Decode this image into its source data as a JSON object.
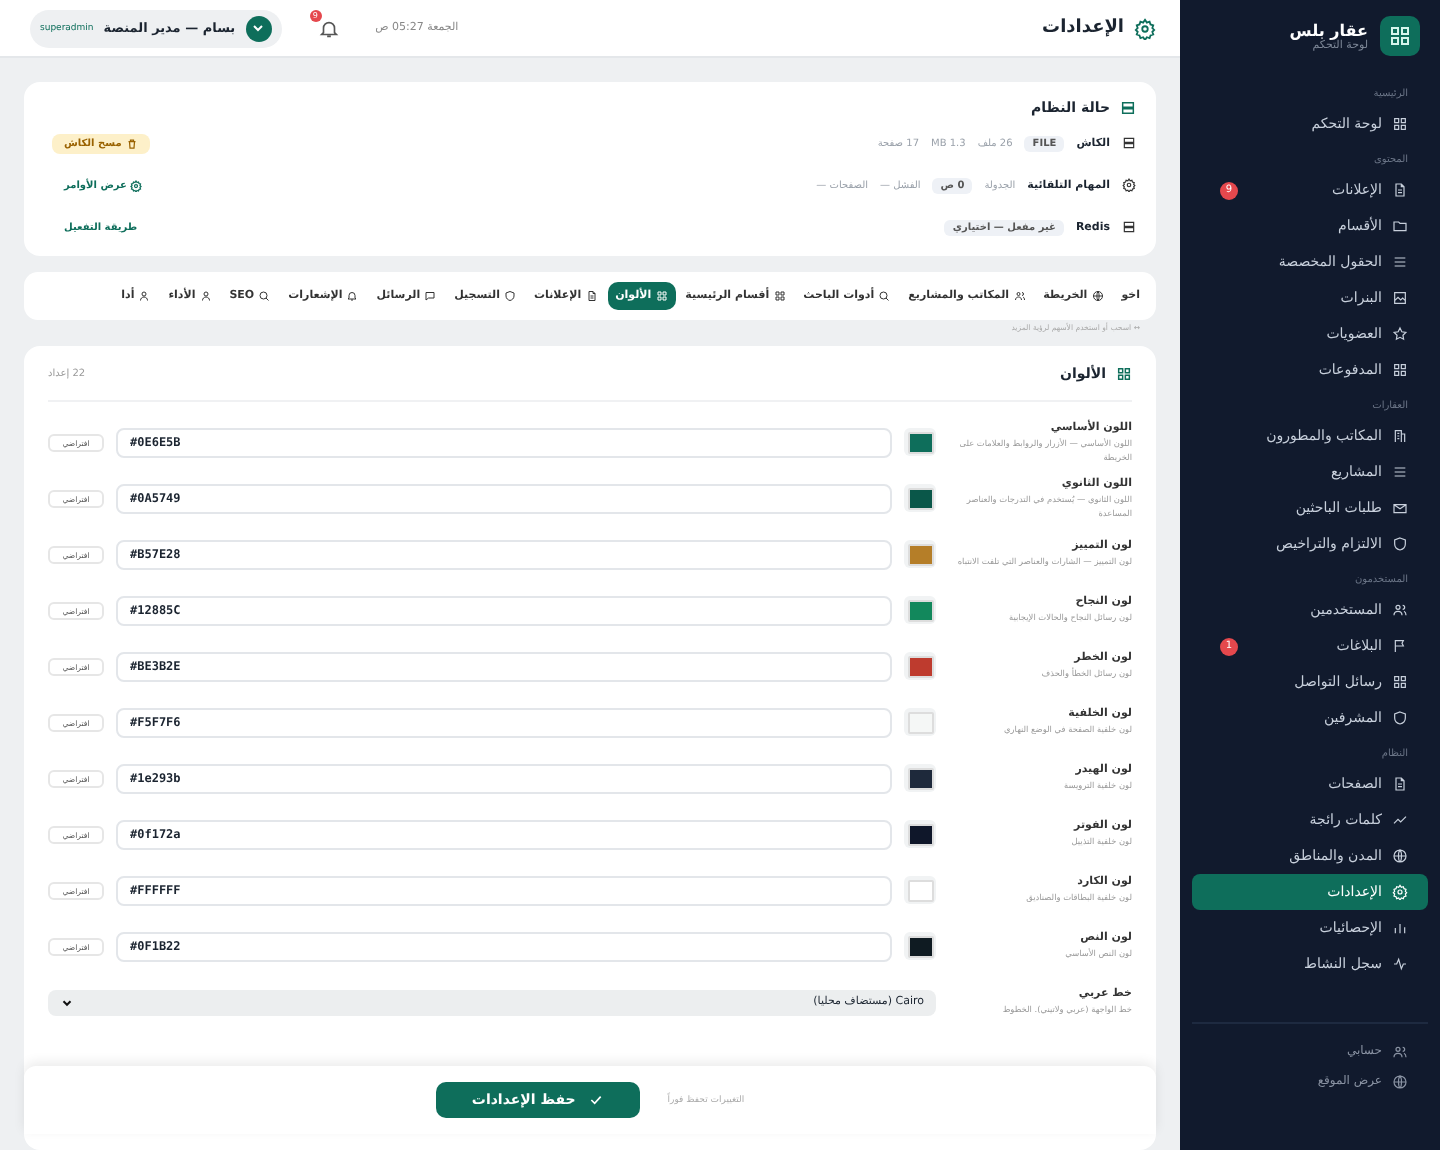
{
  "sidebar": {
    "brand": {
      "name": "عقار بلس",
      "subtitle": "لوحة التحكم"
    },
    "sections": [
      {
        "title": "الرئيسية",
        "items": [
          {
            "label": "لوحة التحكم",
            "selected": false
          }
        ]
      },
      {
        "title": "المحتوى",
        "items": [
          {
            "label": "الإعلانات",
            "selected": false,
            "badge": "9"
          },
          {
            "label": "الأقسام",
            "selected": false
          },
          {
            "label": "الحقول المخصصة",
            "selected": false
          },
          {
            "label": "البنرات",
            "selected": false
          },
          {
            "label": "العضويات",
            "selected": false
          },
          {
            "label": "المدفوعات",
            "selected": false
          }
        ]
      },
      {
        "title": "العقارات",
        "items": [
          {
            "label": "المكاتب والمطورون",
            "selected": false
          },
          {
            "label": "المشاريع",
            "selected": false
          },
          {
            "label": "طلبات الباحثين",
            "selected": false
          },
          {
            "label": "الالتزام والتراخيص",
            "selected": false
          }
        ]
      },
      {
        "title": "المستخدمون",
        "items": [
          {
            "label": "المستخدمين",
            "selected": false
          },
          {
            "label": "البلاغات",
            "selected": false,
            "badge": "1"
          },
          {
            "label": "رسائل التواصل",
            "selected": false
          },
          {
            "label": "المشرفين",
            "selected": false
          }
        ]
      },
      {
        "title": "النظام",
        "items": [
          {
            "label": "الصفحات",
            "selected": false
          },
          {
            "label": "كلمات رائجة",
            "selected": false
          },
          {
            "label": "المدن والمناطق",
            "selected": false
          },
          {
            "label": "الإعدادات",
            "selected": true
          },
          {
            "label": "الإحصائيات",
            "selected": false
          },
          {
            "label": "سجل النشاط",
            "selected": false
          }
        ]
      }
    ],
    "footer": [
      "حسابي",
      "عرض الموقع"
    ]
  },
  "header": {
    "title": "الإعدادات",
    "datetime": "الجمعة 05:27 ص",
    "notifications": "9",
    "user": {
      "name": "بسام — مدير المنصة",
      "role": "superadmin"
    }
  },
  "system_status": {
    "title": "حالة النظام",
    "rows": [
      {
        "label": "الكاش",
        "parts": [
          {
            "text": "FILE",
            "boxed": true
          },
          {
            "text": "26 ملف",
            "boxed": false
          },
          {
            "text": "1.3 MB",
            "boxed": false
          },
          {
            "text": "17 صفحة",
            "boxed": false
          }
        ],
        "action": {
          "label": "مسح الكاش",
          "kind": "warning"
        }
      },
      {
        "label": "المهام التلقائية",
        "parts": [
          {
            "text": "الجدولة",
            "boxed": false
          },
          {
            "text": "0 ص",
            "boxed": true
          },
          {
            "text": "الفشل —",
            "boxed": false
          },
          {
            "text": "الصفحات —",
            "boxed": false
          }
        ],
        "action": {
          "label": "عرض الأوامر",
          "kind": "link"
        }
      },
      {
        "label": "Redis",
        "parts": [
          {
            "text": "غير مفعل — اختياري",
            "boxed": true
          }
        ],
        "action": {
          "label": "طريقة التفعيل",
          "kind": "plain"
        }
      }
    ]
  },
  "tabs": [
    {
      "label": "اخو",
      "selected": false
    },
    {
      "label": "الخريطة",
      "selected": false
    },
    {
      "label": "المكاتب والمشاريع",
      "selected": false
    },
    {
      "label": "أدوات الباحث",
      "selected": false
    },
    {
      "label": "أقسام الرئيسية",
      "selected": false
    },
    {
      "label": "الألوان",
      "selected": true
    },
    {
      "label": "الإعلانات",
      "selected": false
    },
    {
      "label": "التسجيل",
      "selected": false
    },
    {
      "label": "الرسائل",
      "selected": false
    },
    {
      "label": "الإشعارات",
      "selected": false
    },
    {
      "label": "SEO",
      "selected": false
    },
    {
      "label": "الأداء",
      "selected": false
    },
    {
      "label": "أدا",
      "selected": false
    }
  ],
  "tabs_hint": "↔ اسحب أو استخدم الأسهم لرؤية المزيد",
  "colors": {
    "title": "الألوان",
    "count": "22 إعداد",
    "rows": [
      {
        "kind": "color",
        "label": "اللون الأساسي",
        "description": "اللون الأساسي — الأزرار والروابط والعلامات على الخريطة",
        "value": "#0E6E5B",
        "reset": "افتراضي"
      },
      {
        "kind": "color",
        "label": "اللون الثانوي",
        "description": "اللون الثانوي — يُستخدم في التدرجات والعناصر المساعدة",
        "value": "#0A5749",
        "reset": "افتراضي"
      },
      {
        "kind": "color",
        "label": "لون التمييز",
        "description": "لون التمييز — الشارات والعناصر التي تلفت الانتباه",
        "value": "#B57E28",
        "reset": "افتراضي"
      },
      {
        "kind": "color",
        "label": "لون النجاح",
        "description": "لون رسائل النجاح والحالات الإيجابية",
        "value": "#12885C",
        "reset": "افتراضي"
      },
      {
        "kind": "color",
        "label": "لون الخطر",
        "description": "لون رسائل الخطأ والحذف",
        "value": "#BE3B2E",
        "reset": "افتراضي"
      },
      {
        "kind": "color",
        "label": "لون الخلفية",
        "description": "لون خلفية الصفحة في الوضع النهاري",
        "value": "#F5F7F6",
        "reset": "افتراضي"
      },
      {
        "kind": "color",
        "label": "لون الهيدر",
        "description": "لون خلفية الترويسة",
        "value": "#1e293b",
        "reset": "افتراضي"
      },
      {
        "kind": "color",
        "label": "لون الفوتر",
        "description": "لون خلفية التذييل",
        "value": "#0f172a",
        "reset": "افتراضي"
      },
      {
        "kind": "color",
        "label": "لون الكارد",
        "description": "لون خلفية البطاقات والصناديق",
        "value": "#FFFFFF",
        "reset": "افتراضي"
      },
      {
        "kind": "color",
        "label": "لون النص",
        "description": "لون النص الأساسي",
        "value": "#0F1B22",
        "reset": "افتراضي"
      },
      {
        "kind": "select",
        "label": "خط عربي",
        "description": "خط الواجهة (عربي ولاتيني). الخطوط",
        "value": "Cairo (مستضاف محليا)"
      }
    ]
  },
  "save_bar": {
    "button": "حفظ الإعدادات",
    "hint": "التغييرات تحفظ فوراً"
  }
}
